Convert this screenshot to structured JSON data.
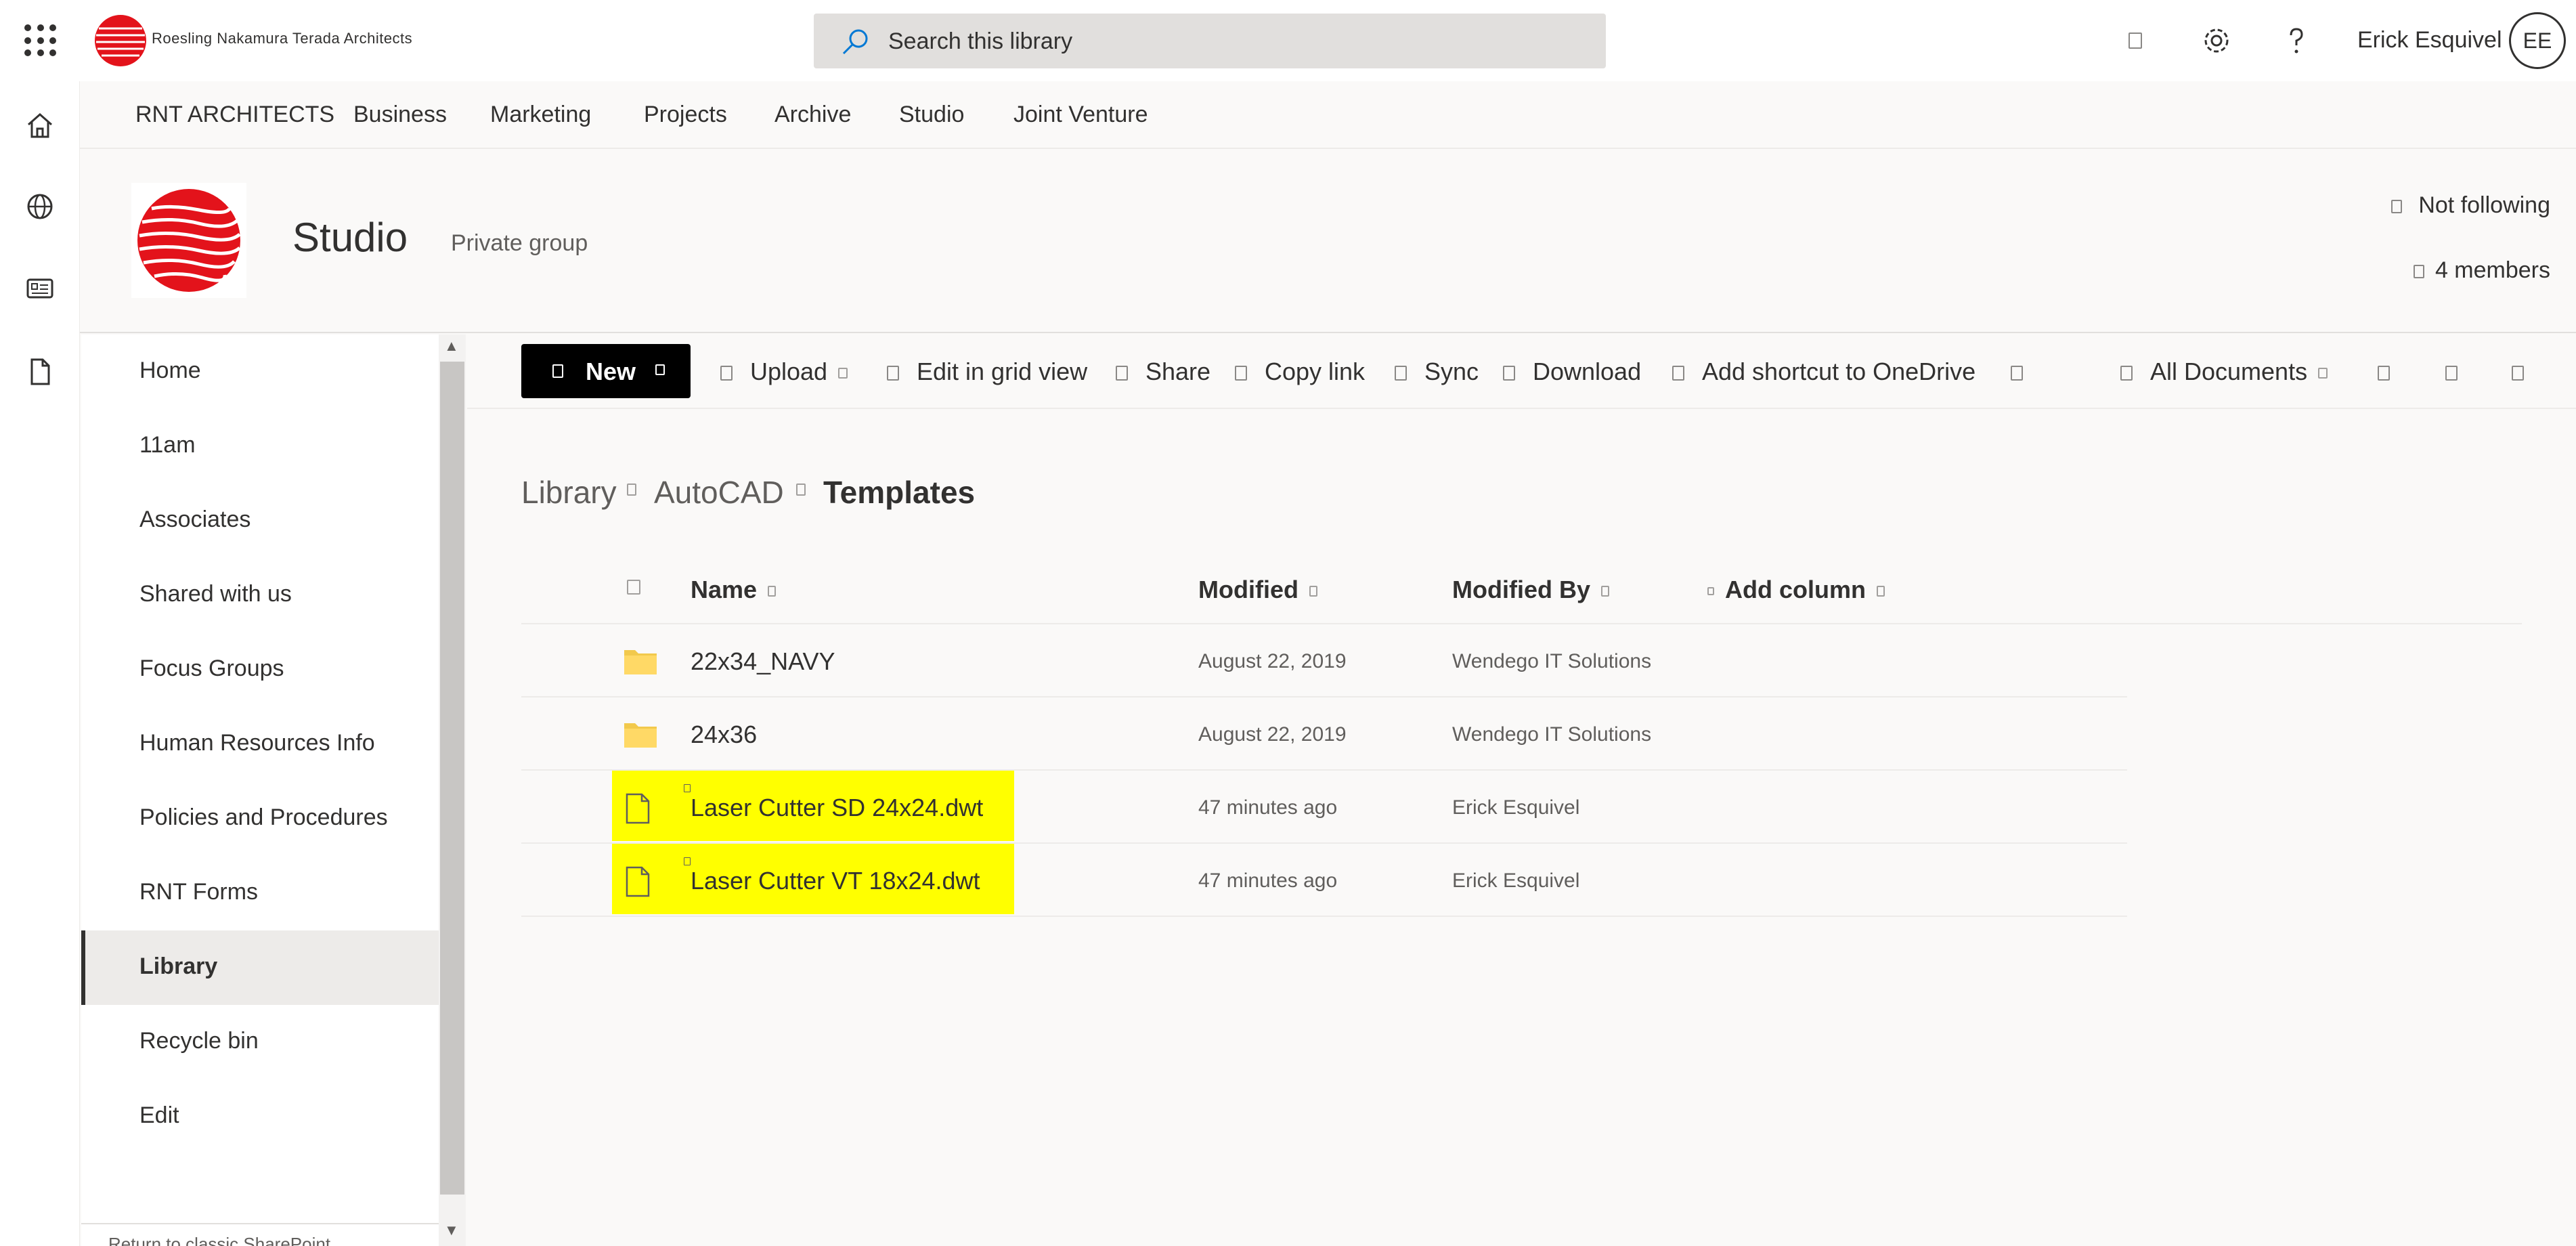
{
  "suite_bar": {
    "org_name": "Roesling Nakamura Terada Architects",
    "search_placeholder": "Search this library",
    "user_name": "Erick Esquivel",
    "user_initials": "EE",
    "icons": [
      "waffle-icon",
      "notifications-icon",
      "settings-gear-icon",
      "help-question-icon"
    ]
  },
  "app_rail": {
    "icons": [
      "home-icon",
      "globe-icon",
      "news-icon",
      "document-icon"
    ]
  },
  "hub_nav": {
    "items": [
      "RNT ARCHITECTS",
      "Business",
      "Marketing",
      "Projects",
      "Archive",
      "Studio",
      "Joint Venture"
    ]
  },
  "site": {
    "title": "Studio",
    "privacy": "Private group",
    "follow_label": "Not following",
    "members_label": "4 members"
  },
  "quick_launch": {
    "items": [
      {
        "label": "Home"
      },
      {
        "label": "11am"
      },
      {
        "label": "Associates"
      },
      {
        "label": "Shared with us"
      },
      {
        "label": "Focus Groups"
      },
      {
        "label": "Human Resources Info"
      },
      {
        "label": "Policies and Procedures"
      },
      {
        "label": "RNT Forms"
      },
      {
        "label": "Library",
        "active": true
      },
      {
        "label": "Recycle bin"
      },
      {
        "label": "Edit"
      }
    ],
    "bottom_text": "Return to classic SharePoint"
  },
  "command_bar": {
    "new_label": "New",
    "upload_label": "Upload",
    "edit_grid_label": "Edit in grid view",
    "share_label": "Share",
    "copy_link_label": "Copy link",
    "sync_label": "Sync",
    "download_label": "Download",
    "shortcut_label": "Add shortcut to OneDrive",
    "view_label": "All Documents"
  },
  "breadcrumb": {
    "items": [
      "Library",
      "AutoCAD"
    ],
    "current": "Templates"
  },
  "list": {
    "columns": {
      "name": "Name",
      "modified": "Modified",
      "modified_by": "Modified By",
      "add_column": "Add column"
    },
    "rows": [
      {
        "type": "folder",
        "name": "22x34_NAVY",
        "modified": "August 22, 2019",
        "modified_by": "Wendego IT Solutions",
        "highlighted": false
      },
      {
        "type": "folder",
        "name": "24x36",
        "modified": "August 22, 2019",
        "modified_by": "Wendego IT Solutions",
        "highlighted": false
      },
      {
        "type": "file",
        "name": "Laser Cutter SD 24x24.dwt",
        "modified": "47 minutes ago",
        "modified_by": "Erick Esquivel",
        "highlighted": true
      },
      {
        "type": "file",
        "name": "Laser Cutter VT 18x24.dwt",
        "modified": "47 minutes ago",
        "modified_by": "Erick Esquivel",
        "highlighted": true
      }
    ]
  },
  "colors": {
    "highlight": "#ffff00",
    "folder": "#f2c94c",
    "logo_red": "#e3131b",
    "new_button_bg": "#000000"
  }
}
